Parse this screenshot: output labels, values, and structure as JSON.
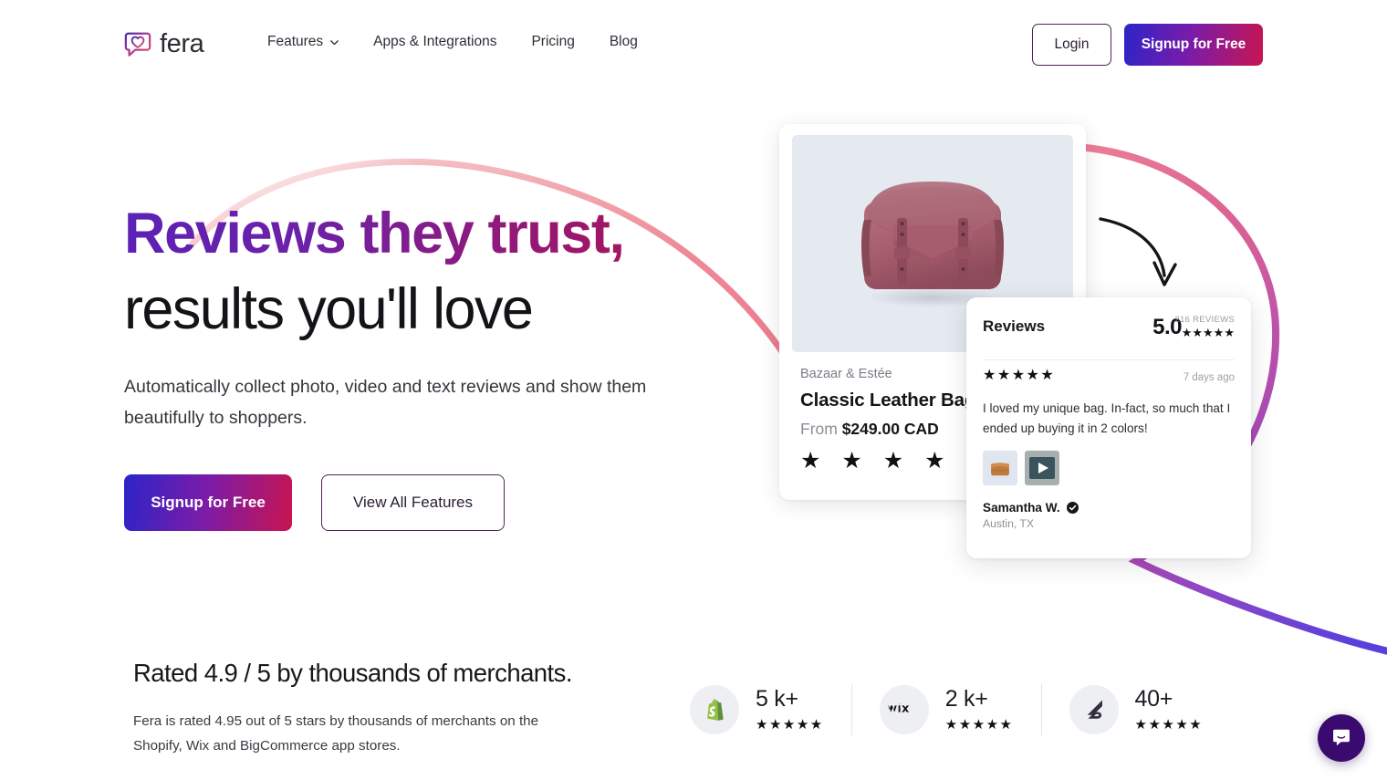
{
  "brand": {
    "name": "fera",
    "logo_icon": "heart-speech-bubble-icon"
  },
  "nav": {
    "items": [
      {
        "label": "Features",
        "has_dropdown": true,
        "icon": "chevron-down-icon"
      },
      {
        "label": "Apps & Integrations",
        "has_dropdown": false
      },
      {
        "label": "Pricing",
        "has_dropdown": false
      },
      {
        "label": "Blog",
        "has_dropdown": false
      }
    ],
    "login_label": "Login",
    "signup_label": "Signup for Free"
  },
  "hero": {
    "title_line1": "Reviews they trust,",
    "title_line2": "results you'll love",
    "subtitle": "Automatically collect photo, video and text reviews and show them beautifully to shoppers.",
    "cta_primary": "Signup for Free",
    "cta_secondary": "View All Features"
  },
  "product_card": {
    "brand": "Bazaar & Estée",
    "title": "Classic Leather Bag",
    "price_prefix": "From",
    "price": "$249.00 CAD",
    "stars": "★ ★ ★ ★ ★",
    "image_alt": "classic-leather-bag-photo"
  },
  "reviews_card": {
    "heading": "Reviews",
    "score": "5.0",
    "count_label": "216 REVIEWS",
    "summary_stars": "★★★★★",
    "review": {
      "stars": "★★★★★",
      "time": "7 days ago",
      "text": "I loved my unique bag. In-fact, so much that I ended up buying it in 2 colors!",
      "media": [
        {
          "type": "photo",
          "name": "review-photo-thumbnail"
        },
        {
          "type": "video",
          "name": "review-video-thumbnail"
        }
      ],
      "author": "Samantha W.",
      "verified_icon": "verified-check-icon",
      "location": "Austin, TX"
    }
  },
  "proof": {
    "title": "Rated 4.9 / 5 by thousands of merchants.",
    "subtitle": "Fera is rated 4.95 out of 5 stars by thousands of merchants on the Shopify, Wix and BigCommerce app stores.",
    "stores": [
      {
        "name": "Shopify",
        "icon": "shopify-icon",
        "count": "5 k+",
        "stars": "★★★★★"
      },
      {
        "name": "Wix",
        "icon": "wix-icon",
        "count": "2 k+",
        "stars": "★★★★★"
      },
      {
        "name": "BigCommerce",
        "icon": "bigcommerce-icon",
        "count": "40+",
        "stars": "★★★★★"
      }
    ]
  },
  "widgets": {
    "intercom_label": "chat-bubble-icon"
  },
  "colors": {
    "gradient_start": "#2c24c8",
    "gradient_mid": "#7a1ca9",
    "gradient_end": "#c81550",
    "heading_purple": "#5b21b6",
    "heading_crimson": "#b3124e",
    "curve_pink": "#ef8a9b",
    "curve_purple": "#6b3fd4",
    "intercom_purple": "#3a0a6e",
    "product_bg": "#e5e9f0"
  }
}
